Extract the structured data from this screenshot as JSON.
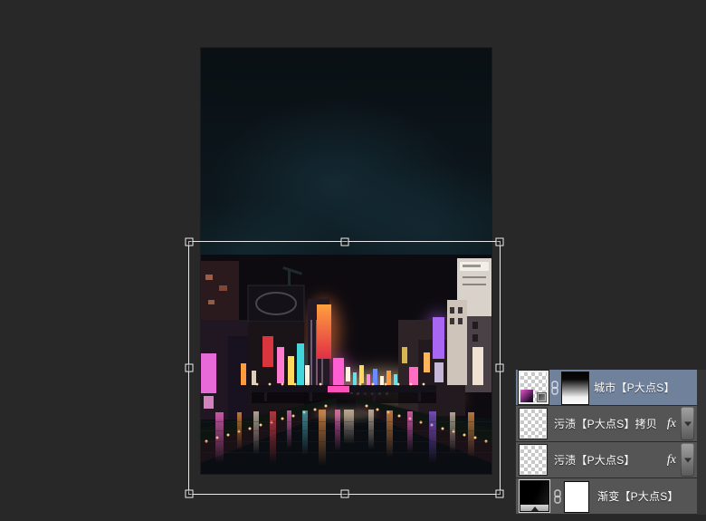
{
  "workspace": {
    "background_color": "#282828",
    "document": {
      "content": "night cityscape with canal and neon signs",
      "sky_color": "#0c161c"
    },
    "transform_box": {
      "handle_count": 8,
      "border_color": "#f3f3f3"
    }
  },
  "layers_panel": {
    "colors": {
      "selected_row": "#70819b",
      "row": "#555555",
      "separator": "#2b2b2b"
    },
    "effects_label": "fx",
    "items": [
      {
        "name": "城市【P大点S】",
        "selected": true,
        "linked": true,
        "thumbnail": "transparent-with-image-and-smart-object-badge",
        "mask": "black-to-white-gradient"
      },
      {
        "name": "污渍【P大点S】拷贝",
        "selected": false,
        "has_effects": true,
        "thumbnail": "transparent"
      },
      {
        "name": "污渍【P大点S】",
        "selected": false,
        "has_effects": true,
        "thumbnail": "transparent"
      },
      {
        "name": "渐变【P大点S】",
        "selected": false,
        "linked": true,
        "thumbnail": "gradient-fill",
        "mask": "white"
      }
    ]
  }
}
